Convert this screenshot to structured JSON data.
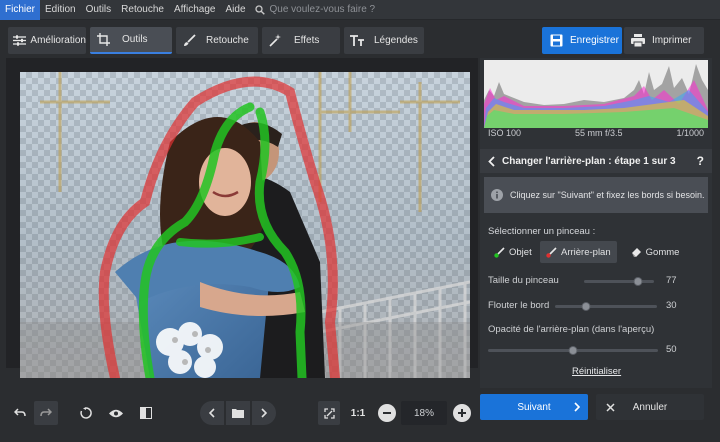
{
  "menu": {
    "items": [
      "Fichier",
      "Edition",
      "Outils",
      "Retouche",
      "Affichage",
      "Aide"
    ],
    "search_placeholder": "Que voulez-vous faire ?"
  },
  "toolbar": {
    "tabs": [
      {
        "label": "Amélioration",
        "icon": "sliders-icon"
      },
      {
        "label": "Outils",
        "icon": "crop-icon",
        "selected": true
      },
      {
        "label": "Retouche",
        "icon": "brush-icon"
      },
      {
        "label": "Effets",
        "icon": "magic-wand-icon"
      },
      {
        "label": "Légendes",
        "icon": "text-icon"
      }
    ],
    "save_label": "Enregistrer",
    "print_label": "Imprimer"
  },
  "histogram": {
    "iso": "ISO 100",
    "lens": "55 mm f/3.5",
    "shutter": "1/1000"
  },
  "step": {
    "title": "Changer l'arrière-plan : étape 1 sur 3",
    "help": "?",
    "info": "Cliquez sur \"Suivant\" et fixez les bords si besoin."
  },
  "brush": {
    "label": "Sélectionner un pinceau :",
    "options": [
      {
        "label": "Objet",
        "icon": "green-brush-icon"
      },
      {
        "label": "Arrière-plan",
        "icon": "red-brush-icon",
        "selected": true
      },
      {
        "label": "Gomme",
        "icon": "eraser-icon"
      }
    ]
  },
  "sliders": {
    "size": {
      "label": "Taille du pinceau",
      "value": "77",
      "fraction": 0.77
    },
    "blur": {
      "label": "Flouter le bord",
      "value": "30",
      "fraction": 0.3
    },
    "opacity": {
      "label": "Opacité de l'arrière-plan (dans l'aperçu)",
      "value": "50",
      "fraction": 0.5
    }
  },
  "reset_label": "Réinitialiser",
  "bottom": {
    "zoom_ratio": "1:1",
    "zoom_value": "18%"
  },
  "actions": {
    "next_label": "Suivant",
    "cancel_label": "Annuler"
  },
  "colors": {
    "accent": "#1a73d9",
    "object_brush": "#22c322",
    "background_brush": "#e03030"
  }
}
